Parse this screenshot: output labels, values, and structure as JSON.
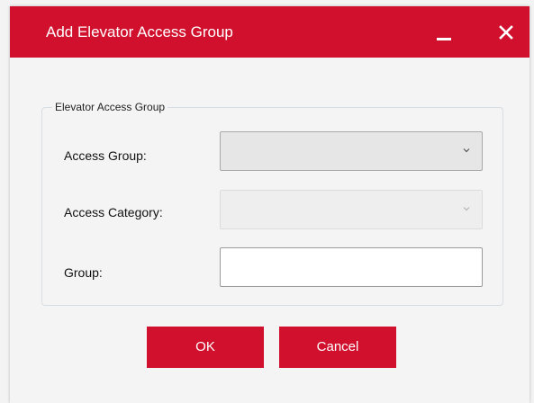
{
  "window": {
    "title": "Add Elevator Access Group"
  },
  "group": {
    "legend": "Elevator Access Group",
    "access_group_label": "Access Group:",
    "access_category_label": "Access Category:",
    "group_label": "Group:",
    "access_group_value": "",
    "access_category_value": "",
    "group_value": ""
  },
  "buttons": {
    "ok": "OK",
    "cancel": "Cancel"
  },
  "colors": {
    "accent": "#d0102d"
  },
  "icons": {
    "minimize": "minimize-icon",
    "close": "close-icon",
    "dropdown": "chevron-down-icon"
  }
}
